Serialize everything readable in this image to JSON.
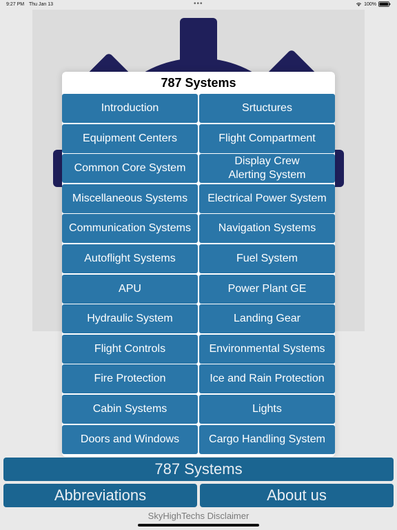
{
  "status_bar": {
    "time": "9:27 PM",
    "date": "Thu Jan 13",
    "dots": "•••",
    "battery": "100%"
  },
  "modal": {
    "title": "787 Systems",
    "items": [
      {
        "label": "Introduction"
      },
      {
        "label": "Srtuctures"
      },
      {
        "label": "Equipment Centers"
      },
      {
        "label": "Flight Compartment"
      },
      {
        "label": "Common Core System"
      },
      {
        "label": "Display Crew\nAlerting System"
      },
      {
        "label": "Miscellaneous Systems"
      },
      {
        "label": "Electrical Power System"
      },
      {
        "label": "Communication Systems"
      },
      {
        "label": "Navigation Systems"
      },
      {
        "label": "Autoflight Systems"
      },
      {
        "label": "Fuel System"
      },
      {
        "label": "APU"
      },
      {
        "label": "Power Plant GE"
      },
      {
        "label": "Hydraulic System"
      },
      {
        "label": "Landing Gear"
      },
      {
        "label": "Flight Controls"
      },
      {
        "label": "Environmental Systems"
      },
      {
        "label": "Fire Protection"
      },
      {
        "label": "Ice and Rain Protection"
      },
      {
        "label": "Cabin Systems"
      },
      {
        "label": "Lights"
      },
      {
        "label": "Doors and Windows"
      },
      {
        "label": "Cargo Handling System"
      }
    ]
  },
  "bottom": {
    "main_label": "787 Systems",
    "abbrev_label": "Abbreviations",
    "about_label": "About us",
    "disclaimer_label": "SkyHighTechs Disclaimer"
  },
  "colors": {
    "button_blue": "#2a76a8",
    "bottom_blue": "#1b6591",
    "gear_navy": "#1f1f5a"
  },
  "icons": [
    "wifi-icon",
    "battery-icon",
    "gear-logo-icon"
  ]
}
